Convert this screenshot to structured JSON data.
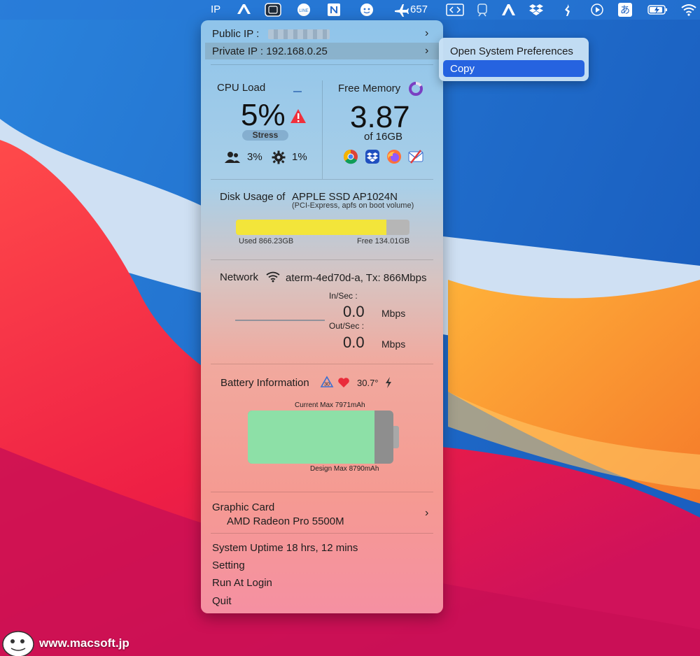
{
  "menubar": {
    "ip_label": "IP",
    "flight_count": "657",
    "kana": "あ"
  },
  "panel": {
    "public_ip_label": "Public IP  :",
    "private_ip": "Private IP : 192.168.0.25",
    "cpu": {
      "title": "CPU Load",
      "percent": "5%",
      "stress_label": "Stress",
      "user_pct": "3%",
      "system_pct": "1%"
    },
    "memory": {
      "title": "Free Memory",
      "value": "3.87",
      "of_total": "of 16GB"
    },
    "disk": {
      "title": "Disk Usage of",
      "drive": "APPLE SSD AP1024N",
      "detail": "(PCI-Express, apfs on boot volume)",
      "used_label": "Used 866.23GB",
      "free_label": "Free 134.01GB",
      "used_fraction": 0.866
    },
    "network": {
      "title": "Network",
      "ssid": "aterm-4ed70d-a, Tx: 866Mbps",
      "in_label": "In/Sec :",
      "in_value": "0.0",
      "in_unit": "Mbps",
      "out_label": "Out/Sec :",
      "out_value": "0.0",
      "out_unit": "Mbps"
    },
    "battery": {
      "title": "Battery Information",
      "temperature": "30.7°",
      "current_max": "Current Max 7971mAh",
      "design_max": "Design Max 8790mAh",
      "cycle_badge": "30"
    },
    "graphics": {
      "title": "Graphic Card",
      "name": "AMD Radeon Pro 5500M"
    },
    "uptime": "System Uptime  18 hrs, 12 mins",
    "setting": "Setting",
    "run_at_login": "Run At Login",
    "quit": "Quit"
  },
  "context_menu": {
    "open_prefs": "Open System Preferences",
    "copy": "Copy"
  },
  "watermark": "www.macsoft.jp"
}
